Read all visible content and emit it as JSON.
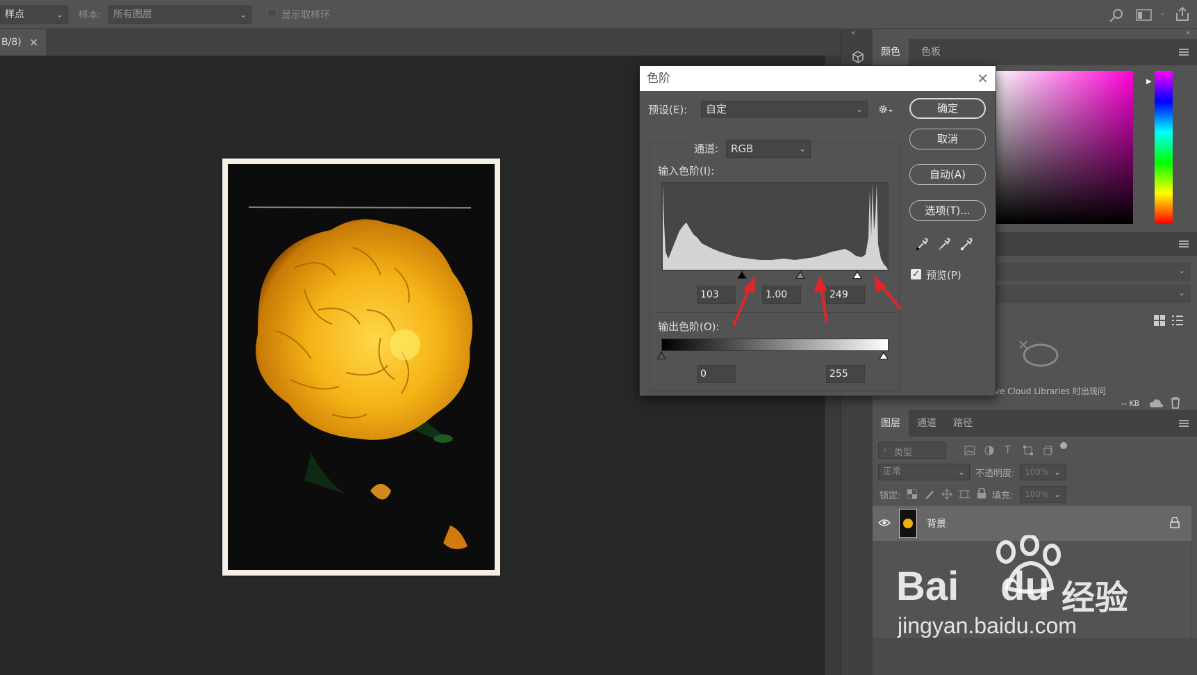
{
  "options_bar": {
    "sample_size": "样点",
    "sample_label": "样本:",
    "sample_value": "所有图层",
    "show_ring": "显示取样环"
  },
  "document": {
    "tab_title": "B/8)",
    "close": "×"
  },
  "color_panel": {
    "tabs": [
      "颜色",
      "色板"
    ]
  },
  "libraries": {
    "text": "Creative Cloud Libraries 时出现问",
    "size": "-- KB"
  },
  "layers_panel": {
    "tabs": [
      "图层",
      "通道",
      "路径"
    ],
    "filter": "类型",
    "blend_mode": "正常",
    "opacity_label": "不透明度:",
    "opacity_value": "100%",
    "lock_label": "锁定:",
    "fill_label": "填充:",
    "fill_value": "100%",
    "layer_name": "背景"
  },
  "levels_dialog": {
    "title": "色阶",
    "preset_label": "预设(E):",
    "preset_value": "自定",
    "channel_label": "通道:",
    "channel_value": "RGB",
    "input_label": "输入色阶(I):",
    "input_black": "103",
    "input_gamma": "1.00",
    "input_white": "249",
    "output_label": "输出色阶(O):",
    "output_black": "0",
    "output_white": "255",
    "buttons": {
      "ok": "确定",
      "cancel": "取消",
      "auto": "自动(A)",
      "options": "选项(T)..."
    },
    "preview_label": "预览(P)",
    "preview_checked": true
  },
  "watermark": {
    "brand": "Bai",
    "brand2": "du",
    "cn": "经验",
    "url": "jingyan.baidu.com"
  },
  "colors": {
    "annotation_arrow": "#e0262a",
    "ui_dark": "#282828",
    "ui_panel": "#535353"
  }
}
